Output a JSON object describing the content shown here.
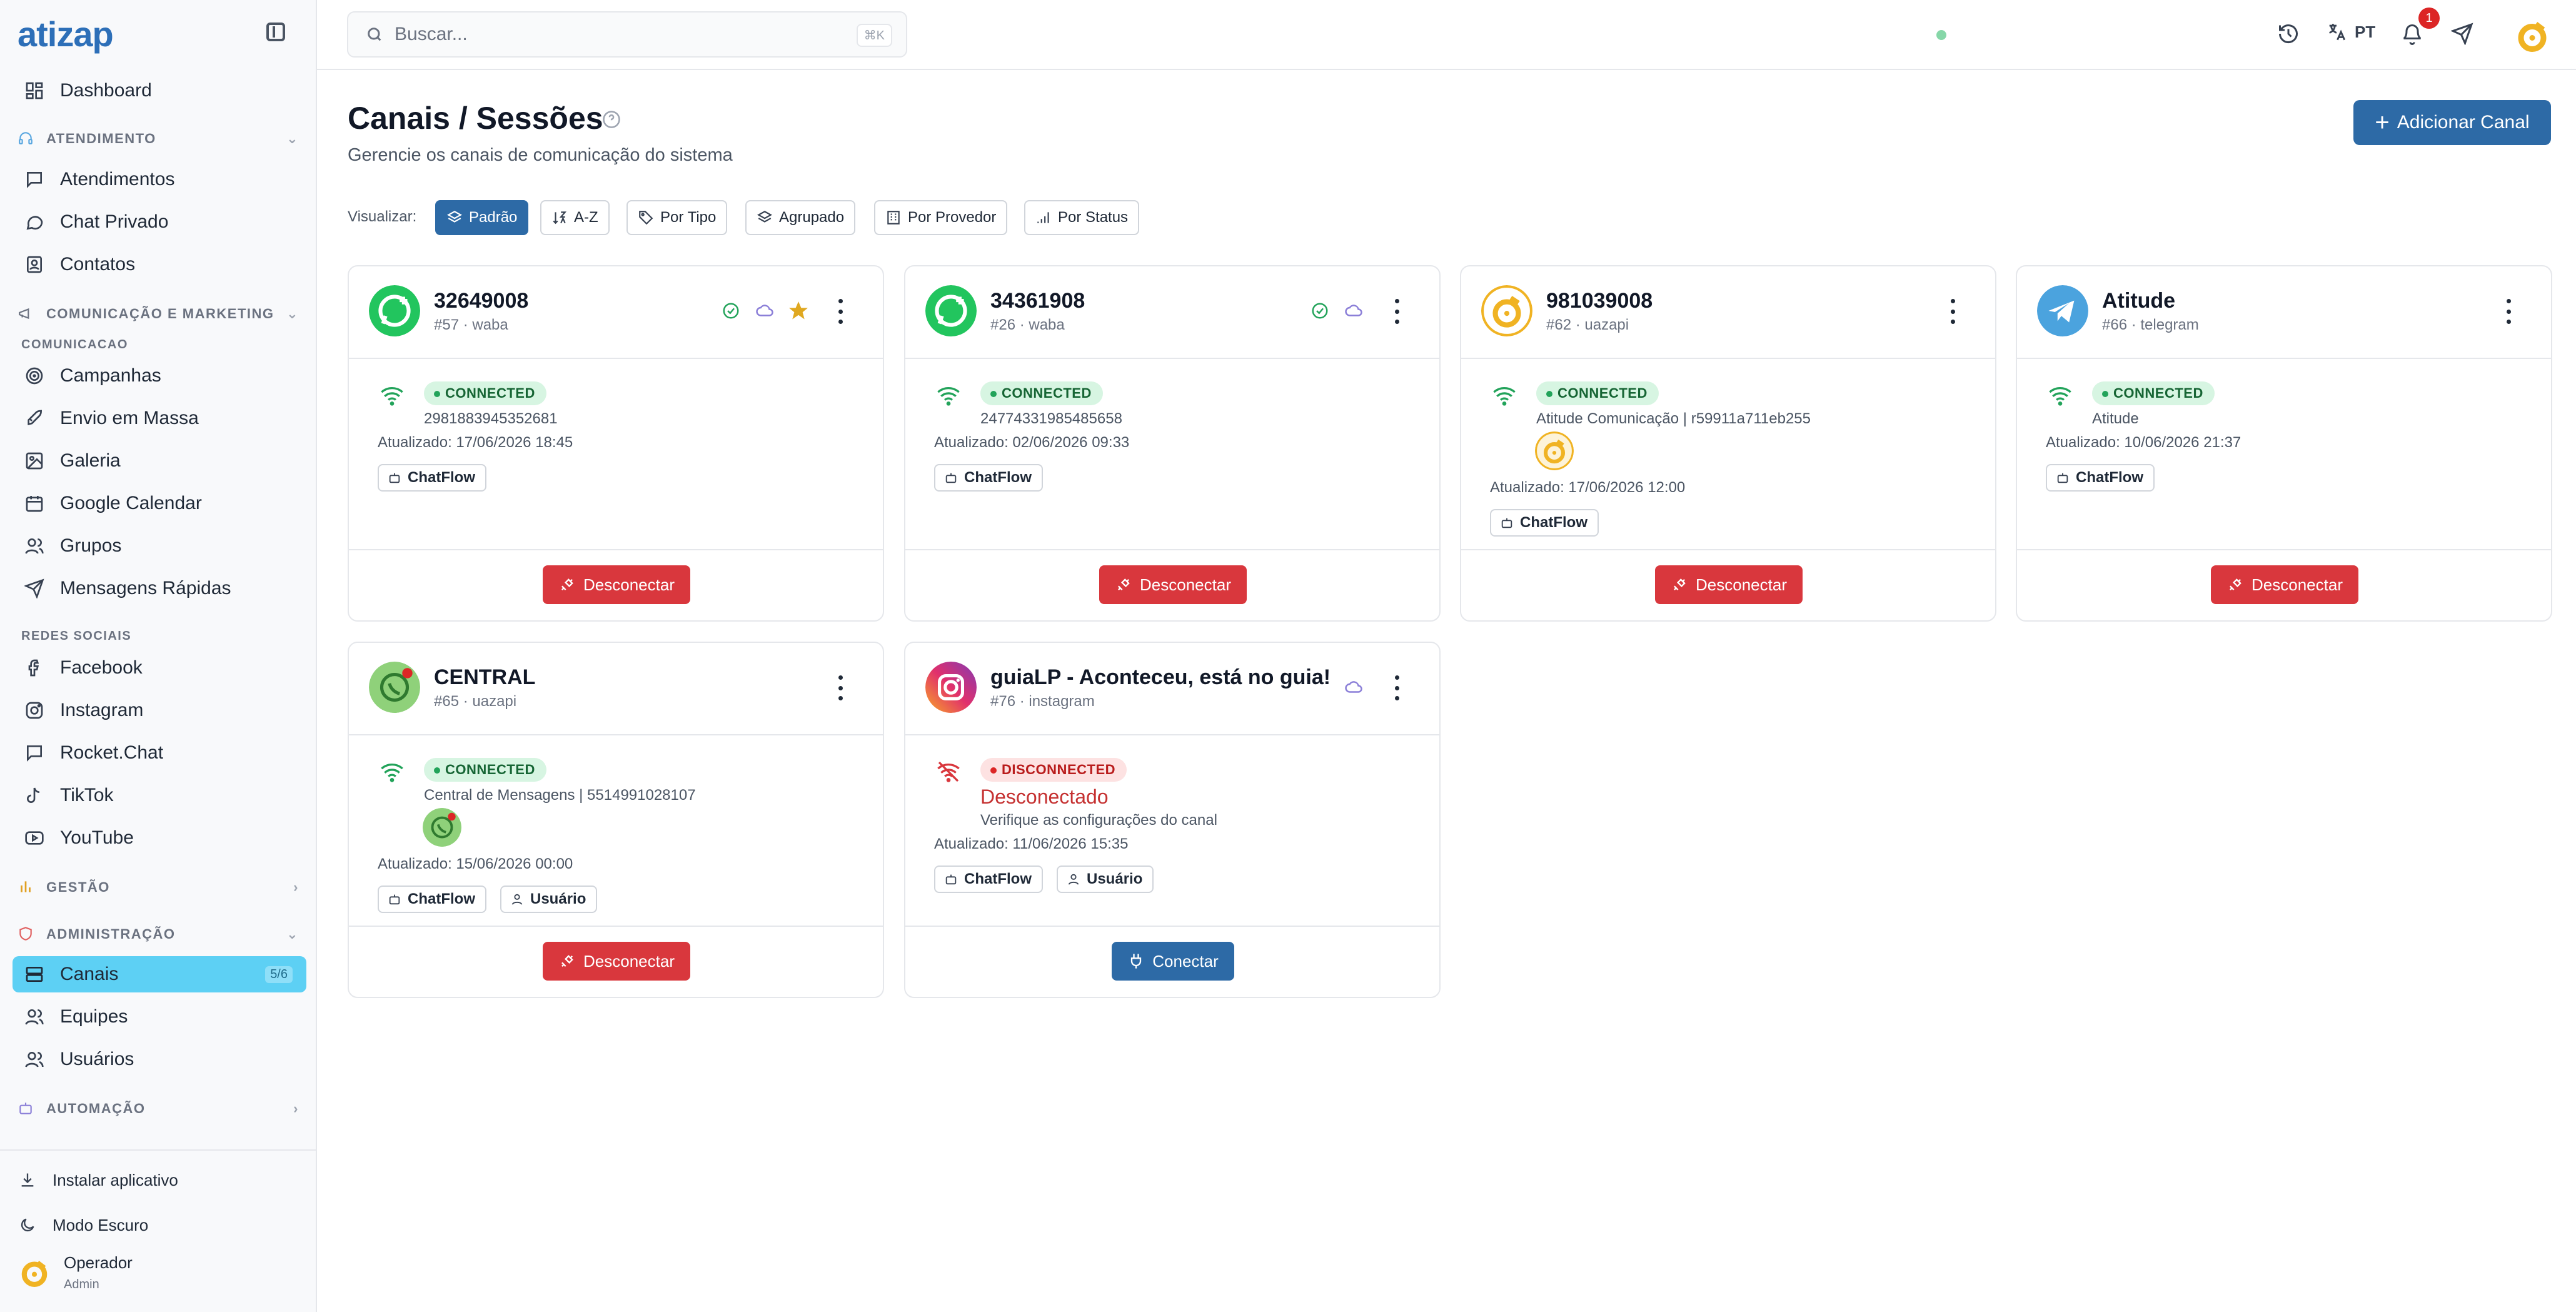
{
  "app": {
    "logo": "atizap"
  },
  "sidebar": {
    "dashboard": "Dashboard",
    "sections": {
      "atendimento": "ATENDIMENTO",
      "comunicacao_marketing": "COMUNICAÇÃO E MARKETING",
      "comunicacao_sub": "COMUNICACAO",
      "redes_sociais": "REDES SOCIAIS",
      "gestao": "GESTÃO",
      "administracao": "ADMINISTRAÇÃO",
      "automacao": "AUTOMAÇÃO"
    },
    "items": {
      "atendimentos": "Atendimentos",
      "chat_privado": "Chat Privado",
      "contatos": "Contatos",
      "campanhas": "Campanhas",
      "envio_massa": "Envio em Massa",
      "galeria": "Galeria",
      "google_calendar": "Google Calendar",
      "grupos": "Grupos",
      "mensagens_rapidas": "Mensagens Rápidas",
      "facebook": "Facebook",
      "instagram": "Instagram",
      "rocket_chat": "Rocket.Chat",
      "tiktok": "TikTok",
      "youtube": "YouTube",
      "canais": "Canais",
      "canais_count": "5/6",
      "equipes": "Equipes",
      "usuarios": "Usuários"
    },
    "bottom": {
      "install": "Instalar aplicativo",
      "dark_mode": "Modo Escuro",
      "user_name": "Operador",
      "user_role": "Admin"
    }
  },
  "topbar": {
    "search_placeholder": "Buscar...",
    "search_shortcut": "⌘K",
    "language": "PT",
    "notifications_count": "1"
  },
  "page": {
    "title": "Canais / Sessões",
    "subtitle": "Gerencie os canais de comunicação do sistema",
    "add_button": "Adicionar Canal",
    "view_label": "Visualizar:",
    "view_modes": [
      "Padrão",
      "A-Z",
      "Por Tipo",
      "Agrupado",
      "Por Provedor",
      "Por Status"
    ]
  },
  "cards": [
    {
      "name": "32649008",
      "meta": "#57 · waba",
      "status": "CONNECTED",
      "detail": "2981883945352681",
      "updated": "Atualizado: 17/06/2026 18:45",
      "tags": [
        "ChatFlow"
      ],
      "action": "Desconectar"
    },
    {
      "name": "34361908",
      "meta": "#26 · waba",
      "status": "CONNECTED",
      "detail": "24774331985485658",
      "updated": "Atualizado: 02/06/2026 09:33",
      "tags": [
        "ChatFlow"
      ],
      "action": "Desconectar"
    },
    {
      "name": "981039008",
      "meta": "#62 · uazapi",
      "status": "CONNECTED",
      "detail": "Atitude Comunicação | r59911a711eb255",
      "updated": "Atualizado: 17/06/2026 12:00",
      "tags": [
        "ChatFlow"
      ],
      "action": "Desconectar"
    },
    {
      "name": "Atitude",
      "meta": "#66 · telegram",
      "status": "CONNECTED",
      "detail": "Atitude",
      "updated": "Atualizado: 10/06/2026 21:37",
      "tags": [
        "ChatFlow"
      ],
      "action": "Desconectar"
    },
    {
      "name": "CENTRAL",
      "meta": "#65 · uazapi",
      "status": "CONNECTED",
      "detail": "Central de Mensagens | 5514991028107",
      "updated": "Atualizado: 15/06/2026 00:00",
      "tags": [
        "ChatFlow",
        "Usuário"
      ],
      "action": "Desconectar"
    },
    {
      "name": "guiaLP - Aconteceu, está no guia!",
      "meta": "#76 · instagram",
      "status": "DISCONNECTED",
      "status_title": "Desconectado",
      "detail": "Verifique as configurações do canal",
      "updated": "Atualizado: 11/06/2026 15:35",
      "tags": [
        "ChatFlow",
        "Usuário"
      ],
      "action": "Conectar"
    }
  ],
  "colors": {
    "brand": "#2d6fb8",
    "primary_button": "#2d6aa6",
    "danger": "#d9373d",
    "active_nav": "#5dd0f4",
    "connected": "#22a35a"
  }
}
